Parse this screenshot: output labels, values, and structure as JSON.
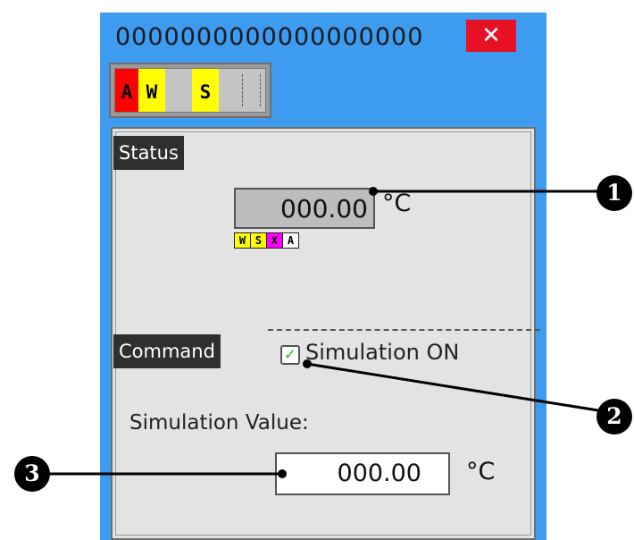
{
  "window": {
    "title": "0000000000000000000",
    "close_glyph": "✕"
  },
  "alarm_flags": [
    {
      "label": "A",
      "color": "#ff0000"
    },
    {
      "label": "W",
      "color": "#ffff00"
    },
    {
      "label": "",
      "color": "#c4c4c4"
    },
    {
      "label": "S",
      "color": "#ffff00"
    }
  ],
  "status": {
    "heading": "Status",
    "value": "000.00",
    "unit": "°C",
    "quality_flags": [
      {
        "label": "W",
        "color": "#ffff00"
      },
      {
        "label": "S",
        "color": "#ffff00"
      },
      {
        "label": "X",
        "color": "#ff00ff"
      },
      {
        "label": "A",
        "color": "#ffffff"
      }
    ]
  },
  "command": {
    "heading": "Command",
    "simulation_checkbox_label": "Simulation ON",
    "simulation_checked": true,
    "check_glyph": "✓",
    "simulation_value_label": "Simulation Value:",
    "simulation_value": "000.00",
    "unit": "°C"
  },
  "callouts": [
    "1",
    "2",
    "3"
  ]
}
